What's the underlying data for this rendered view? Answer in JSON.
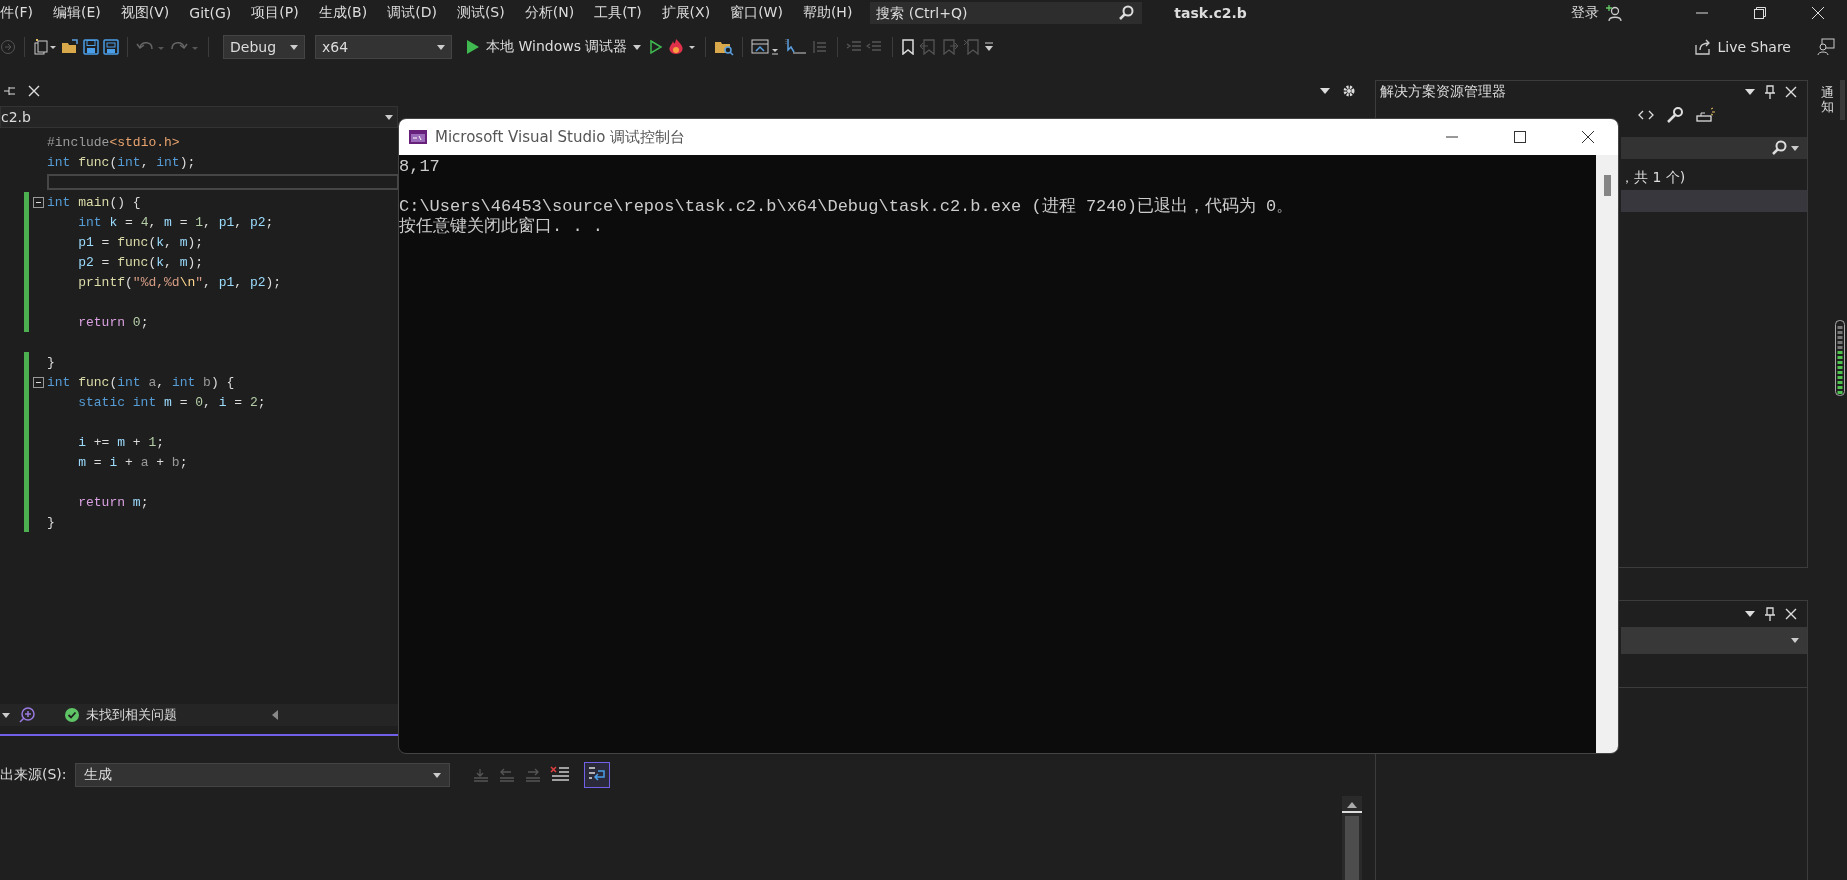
{
  "menu_bar": {
    "items": [
      "件(F)",
      "编辑(E)",
      "视图(V)",
      "Git(G)",
      "项目(P)",
      "生成(B)",
      "调试(D)",
      "测试(S)",
      "分析(N)",
      "工具(T)",
      "扩展(X)",
      "窗口(W)",
      "帮助(H)"
    ],
    "search": {
      "placeholder": "搜索 (Ctrl+Q)"
    },
    "title": "task.c2.b",
    "sign_in": "登录"
  },
  "toolbar": {
    "configuration": "Debug",
    "platform": "x64",
    "run": "本地 Windows 调试器",
    "live_share": "Live Share"
  },
  "editor": {
    "navigation": "c2.b",
    "lines": [
      {
        "changed": false,
        "fold": false,
        "current": false,
        "tokens": [
          {
            "kind": "pre",
            "text": "#include"
          },
          {
            "kind": "inc",
            "text": "<stdio.h>"
          }
        ]
      },
      {
        "changed": false,
        "fold": false,
        "current": false,
        "tokens": [
          {
            "kind": "kw",
            "text": "int "
          },
          {
            "kind": "fn",
            "text": "func"
          },
          {
            "kind": "p",
            "text": "("
          },
          {
            "kind": "kw",
            "text": "int"
          },
          {
            "kind": "p",
            "text": ", "
          },
          {
            "kind": "kw",
            "text": "int"
          },
          {
            "kind": "p",
            "text": ");"
          }
        ]
      },
      {
        "changed": false,
        "fold": false,
        "current": true
      },
      {
        "changed": true,
        "fold": true,
        "current": false,
        "tokens": [
          {
            "kind": "kw",
            "text": "int "
          },
          {
            "kind": "fn",
            "text": "main"
          },
          {
            "kind": "p",
            "text": "() {"
          }
        ]
      },
      {
        "changed": true,
        "fold": false,
        "current": false,
        "tokens": [
          {
            "kind": "kw",
            "text": "    int "
          },
          {
            "kind": "var",
            "text": "k"
          },
          {
            "kind": "p",
            "text": " = "
          },
          {
            "kind": "num",
            "text": "4"
          },
          {
            "kind": "p",
            "text": ", "
          },
          {
            "kind": "var",
            "text": "m"
          },
          {
            "kind": "p",
            "text": " = "
          },
          {
            "kind": "num",
            "text": "1"
          },
          {
            "kind": "p",
            "text": ", "
          },
          {
            "kind": "var",
            "text": "p1"
          },
          {
            "kind": "p",
            "text": ", "
          },
          {
            "kind": "var",
            "text": "p2"
          },
          {
            "kind": "p",
            "text": ";"
          }
        ]
      },
      {
        "changed": true,
        "fold": false,
        "current": false,
        "tokens": [
          {
            "kind": "var",
            "text": "    p1"
          },
          {
            "kind": "p",
            "text": " = "
          },
          {
            "kind": "fn",
            "text": "func"
          },
          {
            "kind": "p",
            "text": "("
          },
          {
            "kind": "var",
            "text": "k"
          },
          {
            "kind": "p",
            "text": ", "
          },
          {
            "kind": "var",
            "text": "m"
          },
          {
            "kind": "p",
            "text": ");"
          }
        ]
      },
      {
        "changed": true,
        "fold": false,
        "current": false,
        "tokens": [
          {
            "kind": "var",
            "text": "    p2"
          },
          {
            "kind": "p",
            "text": " = "
          },
          {
            "kind": "fn",
            "text": "func"
          },
          {
            "kind": "p",
            "text": "("
          },
          {
            "kind": "var",
            "text": "k"
          },
          {
            "kind": "p",
            "text": ", "
          },
          {
            "kind": "var",
            "text": "m"
          },
          {
            "kind": "p",
            "text": ");"
          }
        ]
      },
      {
        "changed": true,
        "fold": false,
        "current": false,
        "tokens": [
          {
            "kind": "fn",
            "text": "    printf"
          },
          {
            "kind": "p",
            "text": "("
          },
          {
            "kind": "str",
            "text": "\"%d,%d"
          },
          {
            "kind": "esc",
            "text": "\\n"
          },
          {
            "kind": "str",
            "text": "\""
          },
          {
            "kind": "p",
            "text": ", "
          },
          {
            "kind": "var",
            "text": "p1"
          },
          {
            "kind": "p",
            "text": ", "
          },
          {
            "kind": "var",
            "text": "p2"
          },
          {
            "kind": "p",
            "text": ");"
          }
        ]
      },
      {
        "changed": true,
        "fold": false,
        "current": false
      },
      {
        "changed": true,
        "fold": false,
        "current": false,
        "tokens": [
          {
            "kind": "ctl",
            "text": "    return "
          },
          {
            "kind": "num",
            "text": "0"
          },
          {
            "kind": "p",
            "text": ";"
          }
        ]
      },
      {
        "changed": false,
        "fold": false,
        "current": false
      },
      {
        "changed": true,
        "fold": false,
        "current": false,
        "tokens": [
          {
            "kind": "p",
            "text": "}"
          }
        ]
      },
      {
        "changed": true,
        "fold": true,
        "current": false,
        "tokens": [
          {
            "kind": "kw",
            "text": "int "
          },
          {
            "kind": "fn",
            "text": "func"
          },
          {
            "kind": "p",
            "text": "("
          },
          {
            "kind": "kw",
            "text": "int "
          },
          {
            "kind": "param",
            "text": "a"
          },
          {
            "kind": "p",
            "text": ", "
          },
          {
            "kind": "kw",
            "text": "int "
          },
          {
            "kind": "param",
            "text": "b"
          },
          {
            "kind": "p",
            "text": ") {"
          }
        ]
      },
      {
        "changed": true,
        "fold": false,
        "current": false,
        "tokens": [
          {
            "kind": "kw",
            "text": "    static int "
          },
          {
            "kind": "var",
            "text": "m"
          },
          {
            "kind": "p",
            "text": " = "
          },
          {
            "kind": "num",
            "text": "0"
          },
          {
            "kind": "p",
            "text": ", "
          },
          {
            "kind": "var",
            "text": "i"
          },
          {
            "kind": "p",
            "text": " = "
          },
          {
            "kind": "num",
            "text": "2"
          },
          {
            "kind": "p",
            "text": ";"
          }
        ]
      },
      {
        "changed": true,
        "fold": false,
        "current": false
      },
      {
        "changed": true,
        "fold": false,
        "current": false,
        "tokens": [
          {
            "kind": "var",
            "text": "    i"
          },
          {
            "kind": "p",
            "text": " += "
          },
          {
            "kind": "var",
            "text": "m"
          },
          {
            "kind": "p",
            "text": " + "
          },
          {
            "kind": "num",
            "text": "1"
          },
          {
            "kind": "p",
            "text": ";"
          }
        ]
      },
      {
        "changed": true,
        "fold": false,
        "current": false,
        "tokens": [
          {
            "kind": "var",
            "text": "    m"
          },
          {
            "kind": "p",
            "text": " = "
          },
          {
            "kind": "var",
            "text": "i"
          },
          {
            "kind": "p",
            "text": " + "
          },
          {
            "kind": "param",
            "text": "a"
          },
          {
            "kind": "p",
            "text": " + "
          },
          {
            "kind": "param",
            "text": "b"
          },
          {
            "kind": "p",
            "text": ";"
          }
        ]
      },
      {
        "changed": true,
        "fold": false,
        "current": false
      },
      {
        "changed": true,
        "fold": false,
        "current": false,
        "tokens": [
          {
            "kind": "ctl",
            "text": "    return "
          },
          {
            "kind": "var",
            "text": "m"
          },
          {
            "kind": "p",
            "text": ";"
          }
        ]
      },
      {
        "changed": true,
        "fold": false,
        "current": false,
        "tokens": [
          {
            "kind": "p",
            "text": "}"
          }
        ]
      }
    ]
  },
  "error_list": {
    "status": "未找到相关问题"
  },
  "output": {
    "source_label": "出来源(S):",
    "source": "生成",
    "word_wrap": true
  },
  "solution_explorer": {
    "title": "解决方案资源管理器",
    "tree_text": "，共 1 个)"
  },
  "notifications": {
    "label": "通知"
  },
  "console": {
    "title": "Microsoft Visual Studio 调试控制台",
    "blocks": [
      [
        "8,17"
      ],
      [
        "C:\\Users\\46453\\source\\repos\\task.c2.b\\x64\\Debug\\task.c2.b.exe (进程 7240)已退出，代码为 0。",
        "按任意键关闭此窗口. . ."
      ]
    ]
  }
}
